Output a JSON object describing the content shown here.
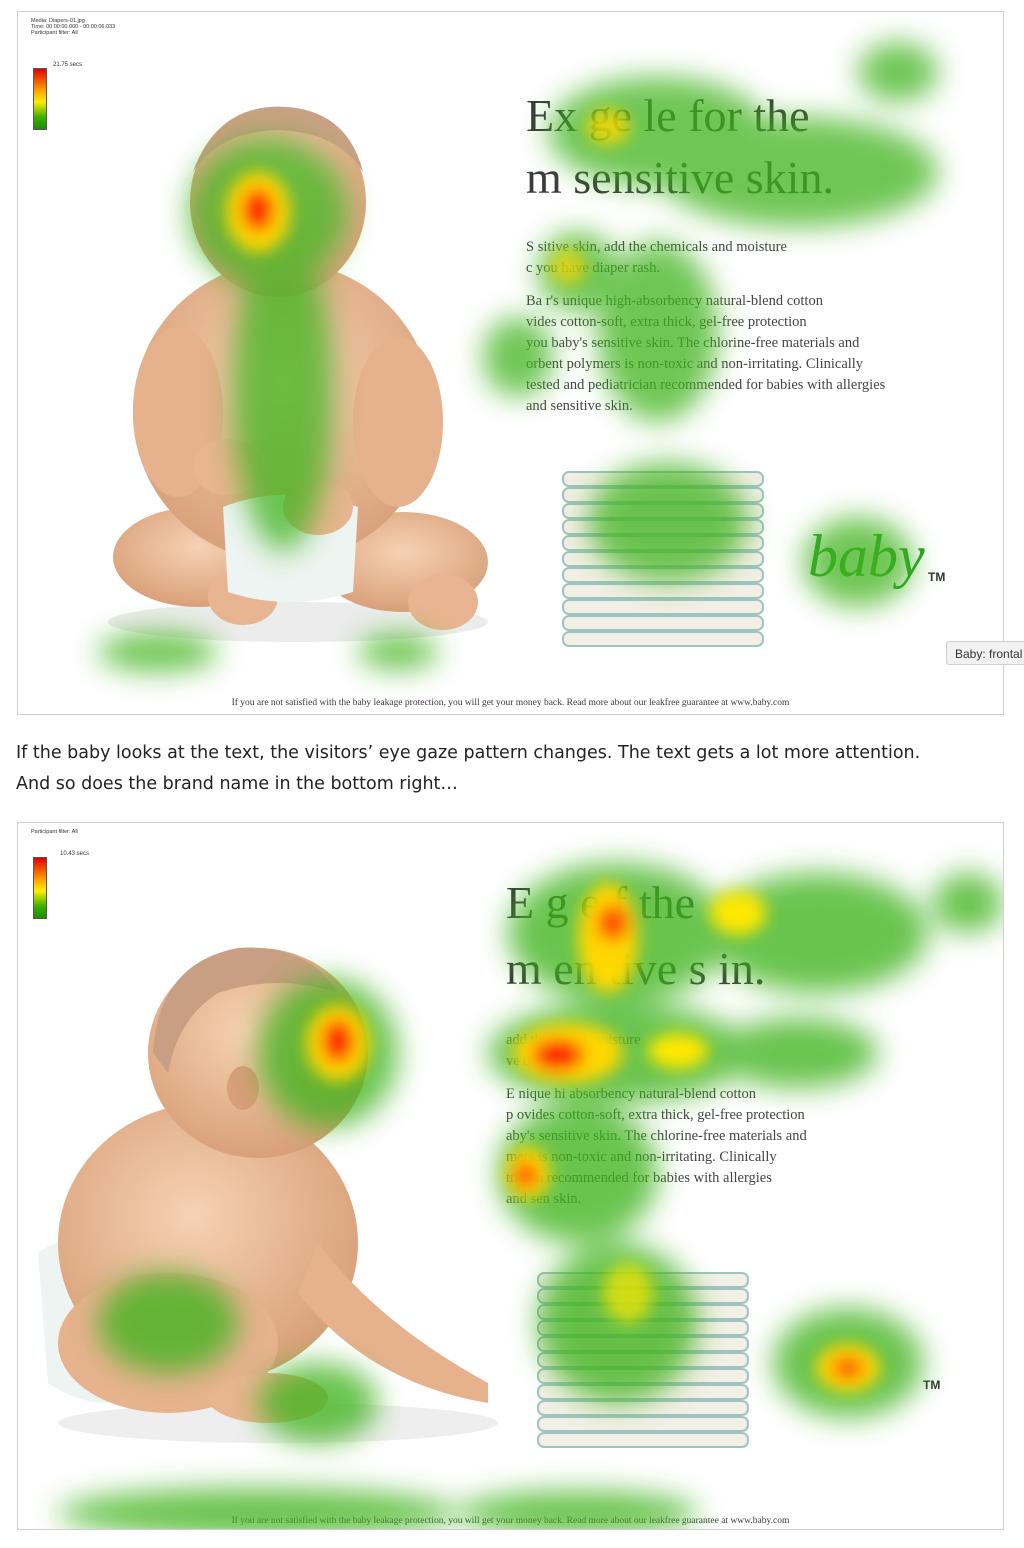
{
  "panel1": {
    "meta": [
      "Media: Diapers-01.jpg",
      "Time: 00:00:00.000 - 00:00:06.033",
      "Participant filter: All"
    ],
    "legend_label": "21.75 secs",
    "headline_line1": "Ex    ge   le for the",
    "headline_line2": "m      sensitive skin.",
    "body_p1": [
      "S               sitive skin, add the chemicals and moisture",
      "c                        you have diaper rash."
    ],
    "body_p2": [
      "Ba        r's unique high-absorbency natural-blend cotton",
      "            vides cotton-soft, extra thick, gel-free protection",
      "     you baby's sensitive skin.  The chlorine-free materials and",
      "    orbent polymers is non-toxic and non-irritating. Clinically",
      "tested and pediatrician recommended for babies with allergies",
      "and sensitive skin."
    ],
    "brand": "baby",
    "tm": "TM",
    "footer": "If you are not satisfied with the baby leakage protection, you will get your money back. Read more about our leakfree guarantee at www.baby.com"
  },
  "tooltip": "Baby: frontal",
  "caption": {
    "line1": "If the baby looks at the text, the visitors’ eye gaze pattern changes. The text gets a lot more attention.",
    "line2": "And so does the brand name in the bottom right…"
  },
  "panel2": {
    "meta": [
      "Participant filter: All"
    ],
    "legend_label": "10.43 secs",
    "headline_line1": "E         g          e f    the",
    "headline_line2": "m      en   tive s  in.",
    "body_p1": [
      "                                   add th           als and moisture",
      "                                       ve d"
    ],
    "body_p2": [
      "E                 nique hi   absorbency natural-blend cotton",
      "p          ovides cotton-soft, extra thick, gel-free protection",
      "          aby's sensitive skin.  The chlorine-free materials and",
      "                mers is non-toxic and non-irritating. Clinically",
      "                    trician recommended for babies with allergies",
      "and sen          skin."
    ],
    "tm": "TM",
    "footer": "If you are not satisfied with the baby leakage protection, you will get your money back. Read more about our leakfree guarantee at www.baby.com"
  },
  "colors": {
    "heat_hot": "#ff1a00",
    "heat_warm": "#ffd800",
    "heat_cool": "#3fb41a",
    "skin": "#f0c09c",
    "diaper": "#eef4f2"
  }
}
